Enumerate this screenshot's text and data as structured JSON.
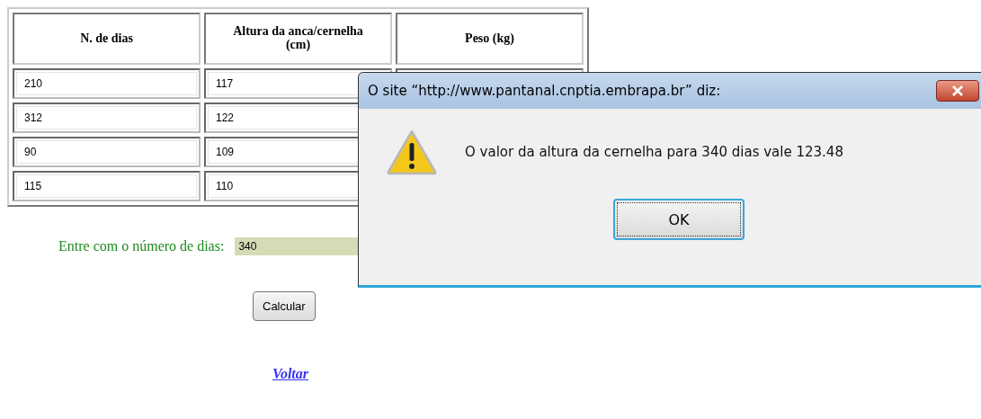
{
  "table": {
    "columns": [
      "N. de dias",
      "Altura da anca/cernelha (cm)",
      "Peso (kg)"
    ],
    "rows": [
      [
        "210",
        "117"
      ],
      [
        "312",
        "122"
      ],
      [
        "90",
        "109"
      ],
      [
        "115",
        "110"
      ]
    ]
  },
  "form": {
    "label": "Entre com o número de dias:",
    "value": "340",
    "button": "Calcular"
  },
  "link": "Voltar",
  "dialog": {
    "title": "O site “http://www.pantanal.cnptia.embrapa.br” diz:",
    "message": "O valor da altura da cernelha para 340 dias vale 123.48",
    "button": "OK"
  }
}
